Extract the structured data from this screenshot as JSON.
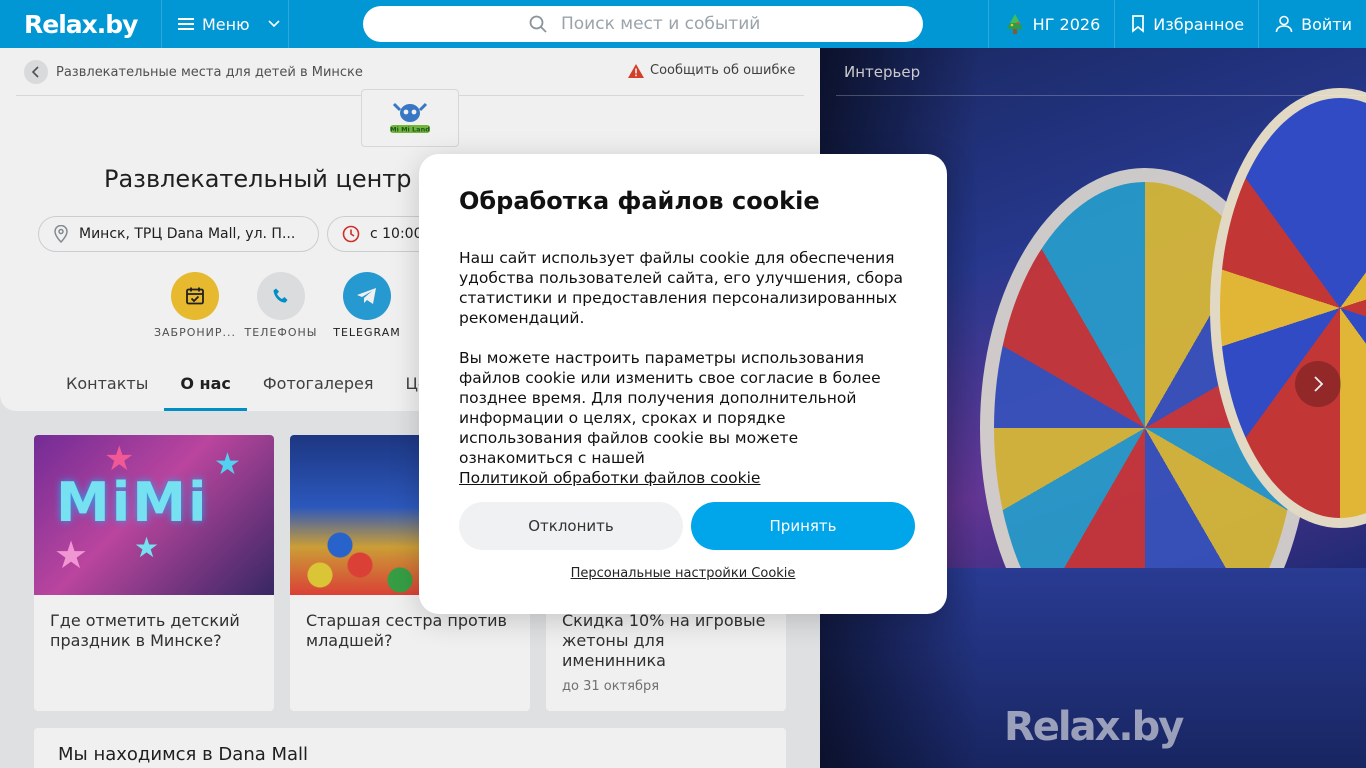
{
  "header": {
    "logo": "Relax.by",
    "menu_label": "Меню",
    "search_placeholder": "Поиск мест и событий",
    "ny_label": "НГ 2026",
    "favorites_label": "Избранное",
    "login_label": "Войти"
  },
  "breadcrumb": {
    "text": "Развлекательные места для детей в Минске"
  },
  "report_error": "Сообщить об ошибке",
  "venue": {
    "logo_text": "Mi Mi Land",
    "title": "Развлекательный центр",
    "address": "Минск, ТРЦ Dana Mall, ул. П...",
    "hours": "с 10:00"
  },
  "actions": [
    {
      "label": "ЗАБРОНИР...",
      "icon": "calendar-check-icon",
      "color": "#f6c532"
    },
    {
      "label": "ТЕЛЕФОНЫ",
      "icon": "phone-icon",
      "color": "#e8eaec"
    },
    {
      "label": "TELEGRAM",
      "icon": "telegram-icon",
      "color": "#2aa3df"
    }
  ],
  "tabs": [
    {
      "label": "Контакты",
      "active": false
    },
    {
      "label": "О нас",
      "active": true
    },
    {
      "label": "Фотогалерея",
      "active": false
    },
    {
      "label": "Цены",
      "active": false
    }
  ],
  "cards": [
    {
      "title": "Где отметить детский праздник в Минске?",
      "image_text": "MiMi",
      "sub": ""
    },
    {
      "title": "Старшая сестра против младшей?",
      "sub": ""
    },
    {
      "title": "Скидка 10% на игровые жетоны для именинника",
      "sub": "до 31 октября"
    }
  ],
  "location_card": {
    "title": "Мы находимся в Dana Mall"
  },
  "gallery": {
    "label": "Интерьер",
    "watermark": "Relax.by"
  },
  "cookie_modal": {
    "title": "Обработка файлов cookie",
    "paragraph1": "Наш сайт использует файлы cookie для обеспечения удобства пользователей сайта, его улучшения, сбора статистики и предоставления персонализированных рекомендаций.",
    "paragraph2": "Вы можете настроить параметры использования файлов cookie или изменить свое согласие в более позднее время. Для получения дополнительной информации о целях, сроках и порядке использования файлов cookie вы можете ознакомиться с нашей",
    "policy_link": "Политикой обработки файлов cookie",
    "decline_label": "Отклонить",
    "accept_label": "Принять",
    "settings_link": "Персональные настройки Cookie"
  },
  "colors": {
    "brand": "#0097d4",
    "accept": "#00a5ea",
    "booking": "#f6c532",
    "telegram": "#2aa3df"
  }
}
